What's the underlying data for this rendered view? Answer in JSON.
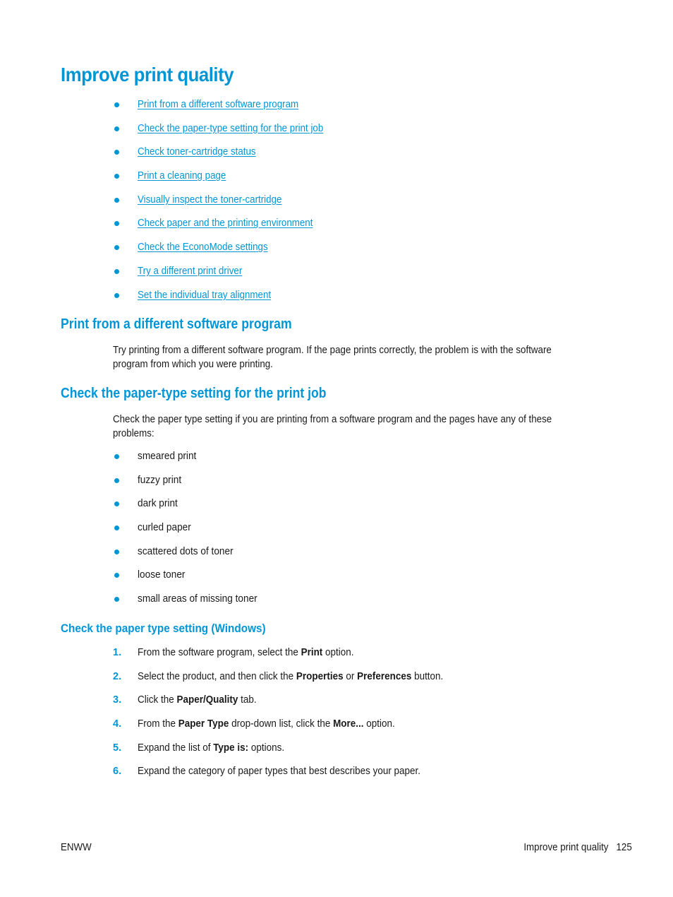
{
  "page": {
    "title": "Improve print quality",
    "toc": [
      "Print from a different software program",
      "Check the paper-type setting for the print job",
      "Check toner-cartridge status",
      "Print a cleaning page",
      "Visually inspect the toner-cartridge",
      "Check paper and the printing environment",
      "Check the EconoMode settings",
      "Try a different print driver",
      "Set the individual tray alignment"
    ]
  },
  "section1": {
    "heading": "Print from a different software program",
    "para_lines": [
      "Try printing from a different software program. If the page prints correctly, the problem is with the software",
      "program from which you were printing."
    ]
  },
  "section2": {
    "heading": "Check the paper-type setting for the print job",
    "para_lines": [
      "Check the paper type setting if you are printing from a software program and the pages have any of these",
      "problems:"
    ],
    "problems": [
      "smeared print",
      "fuzzy print",
      "dark print",
      "curled paper",
      "scattered dots of toner",
      "loose toner",
      "small areas of missing toner"
    ]
  },
  "section3": {
    "heading": "Check the paper type setting (Windows)",
    "steps": [
      {
        "num": "1.",
        "parts": [
          {
            "t": "From the software program, select the "
          },
          {
            "t": "Print",
            "b": true
          },
          {
            "t": " option."
          }
        ]
      },
      {
        "num": "2.",
        "parts": [
          {
            "t": "Select the product, and then click the "
          },
          {
            "t": "Properties",
            "b": true
          },
          {
            "t": " or "
          },
          {
            "t": "Preferences",
            "b": true
          },
          {
            "t": " button."
          }
        ]
      },
      {
        "num": "3.",
        "parts": [
          {
            "t": "Click the "
          },
          {
            "t": "Paper/Quality",
            "b": true
          },
          {
            "t": " tab."
          }
        ]
      },
      {
        "num": "4.",
        "parts": [
          {
            "t": "From the "
          },
          {
            "t": "Paper Type",
            "b": true
          },
          {
            "t": " drop-down list, click the "
          },
          {
            "t": "More...",
            "b": true
          },
          {
            "t": " option."
          }
        ]
      },
      {
        "num": "5.",
        "parts": [
          {
            "t": "Expand the list of "
          },
          {
            "t": "Type is:",
            "b": true
          },
          {
            "t": " options."
          }
        ]
      },
      {
        "num": "6.",
        "parts": [
          {
            "t": "Expand the category of paper types that best describes your paper."
          }
        ]
      }
    ]
  },
  "footer": {
    "left": "ENWW",
    "section": "Improve print quality",
    "page_number": "125"
  },
  "colors": {
    "accent": "#0096d6",
    "text": "#1a1a1a"
  }
}
